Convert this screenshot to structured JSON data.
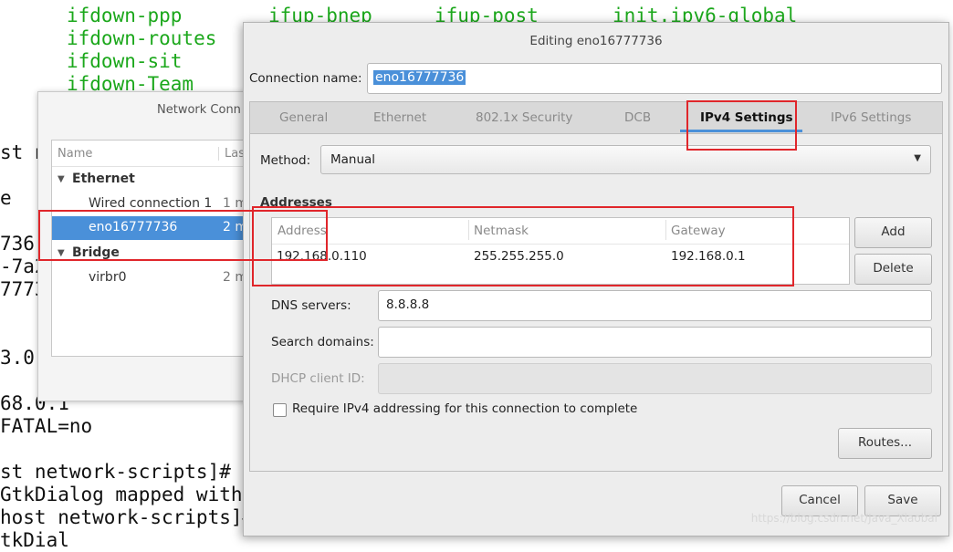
{
  "terminal": {
    "files": [
      "ifdown-ppp",
      "ifup-bnep",
      "ifup-post",
      "init.ipv6-global",
      "ifdown-routes",
      "ifdown-sit",
      "ifdown-Team"
    ],
    "lines": [
      "st n",
      "e",
      "736",
      "-7a2",
      "7773",
      "3.0.",
      "68.0.1",
      "FATAL=no",
      "st network-scripts]#",
      "GtkDialog mapped with",
      "host network-scripts]#",
      "tkDial"
    ]
  },
  "network_window": {
    "title": "Network Conn",
    "columns": [
      "Name",
      "Las"
    ],
    "groups": [
      {
        "name": "Ethernet",
        "items": [
          {
            "name": "Wired connection 1",
            "last": "1 m"
          },
          {
            "name": "eno16777736",
            "last": "2 m"
          }
        ]
      },
      {
        "name": "Bridge",
        "items": [
          {
            "name": "virbr0",
            "last": "2 m"
          }
        ]
      }
    ]
  },
  "dialog": {
    "title": "Editing eno16777736",
    "connection_name_label": "Connection name:",
    "connection_name_value": "eno16777736",
    "tabs": [
      "General",
      "Ethernet",
      "802.1x Security",
      "DCB",
      "IPv4 Settings",
      "IPv6 Settings"
    ],
    "active_tab": "IPv4 Settings",
    "method_label": "Method:",
    "method_value": "Manual",
    "addresses_heading": "Addresses",
    "address_columns": [
      "Address",
      "Netmask",
      "Gateway"
    ],
    "address_rows": [
      {
        "address": "192.168.0.110",
        "netmask": "255.255.255.0",
        "gateway": "192.168.0.1"
      }
    ],
    "add_button": "Add",
    "delete_button": "Delete",
    "dns_label": "DNS servers:",
    "dns_value": "8.8.8.8",
    "search_domains_label": "Search domains:",
    "search_domains_value": "",
    "dhcp_client_id_label": "DHCP client ID:",
    "dhcp_client_id_value": "",
    "require_ipv4_label": "Require IPv4 addressing for this connection to complete",
    "require_ipv4_checked": false,
    "routes_button": "Routes...",
    "cancel_button": "Cancel",
    "save_button": "Save"
  },
  "watermark": "https://blog.csdn.net/Java_Xiaobai",
  "colors": {
    "accent": "#4a90d9",
    "annotation": "#e0262b",
    "terminal_green": "#1ca81c"
  }
}
